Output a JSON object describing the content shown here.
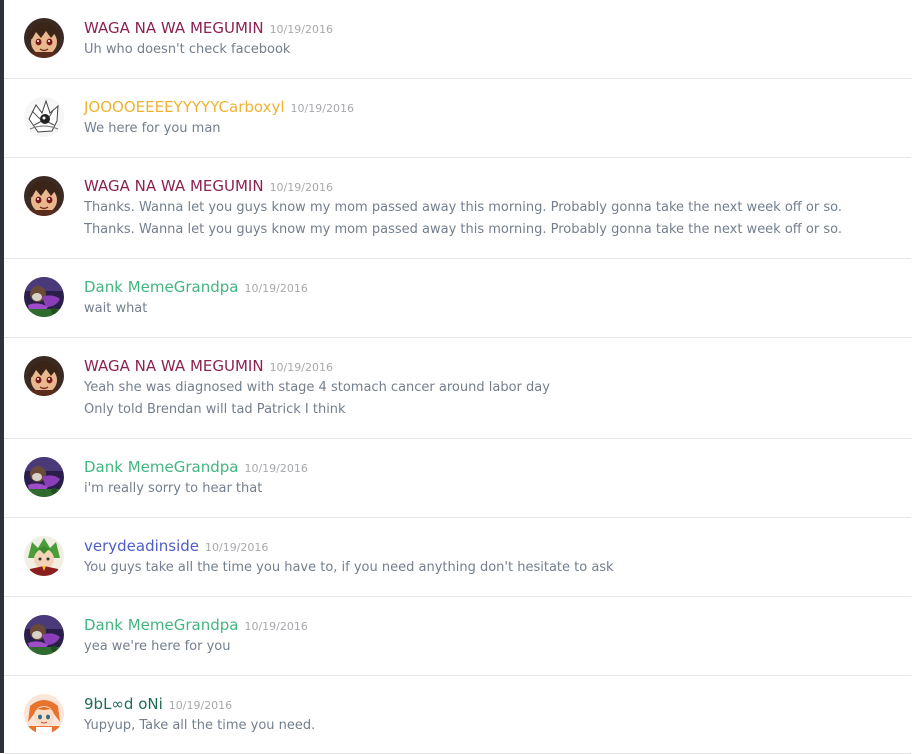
{
  "colors": {
    "megumin": "#8b2252",
    "carboxyl": "#f0b232",
    "dank": "#43b581",
    "verydead": "#4e5dc3",
    "oni": "#1f6b5b",
    "message_text": "#737f8d",
    "timestamp": "#a7a9ac"
  },
  "messages": [
    {
      "username": "WAGA NA WA MEGUMIN",
      "color_key": "megumin",
      "avatar": "megumin-avatar-icon",
      "timestamp": "10/19/2016",
      "lines": [
        "Uh who doesn't check facebook"
      ]
    },
    {
      "username": "JOOOOEEEEYYYYYCarboxyl",
      "color_key": "carboxyl",
      "avatar": "sketch-avatar-icon",
      "timestamp": "10/19/2016",
      "lines": [
        "We here for you man"
      ]
    },
    {
      "username": "WAGA NA WA MEGUMIN",
      "color_key": "megumin",
      "avatar": "megumin-avatar-icon",
      "timestamp": "10/19/2016",
      "lines": [
        "Thanks. Wanna let you guys know my mom passed away this morning. Probably gonna take the next week off or so.",
        "Thanks. Wanna let you guys know my mom passed away this morning. Probably gonna take the next week off or so."
      ]
    },
    {
      "username": "Dank MemeGrandpa",
      "color_key": "dank",
      "avatar": "grandpa-avatar-icon",
      "timestamp": "10/19/2016",
      "lines": [
        "wait what"
      ]
    },
    {
      "username": "WAGA NA WA MEGUMIN",
      "color_key": "megumin",
      "avatar": "megumin-avatar-icon",
      "timestamp": "10/19/2016",
      "lines": [
        "Yeah she was diagnosed with stage 4 stomach cancer around labor day",
        "Only told Brendan will tad Patrick I think"
      ]
    },
    {
      "username": "Dank MemeGrandpa",
      "color_key": "dank",
      "avatar": "grandpa-avatar-icon",
      "timestamp": "10/19/2016",
      "lines": [
        "i'm really sorry to hear that"
      ]
    },
    {
      "username": "verydeadinside",
      "color_key": "verydead",
      "avatar": "green-hair-avatar-icon",
      "timestamp": "10/19/2016",
      "lines": [
        "You guys take all the time you have to, if you need anything don't hesitate to ask"
      ]
    },
    {
      "username": "Dank MemeGrandpa",
      "color_key": "dank",
      "avatar": "grandpa-avatar-icon",
      "timestamp": "10/19/2016",
      "lines": [
        "yea we're here for you"
      ]
    },
    {
      "username": "9bL∞d oNi",
      "color_key": "oni",
      "avatar": "orange-hair-avatar-icon",
      "timestamp": "10/19/2016",
      "lines": [
        "Yupyup, Take all the time you need."
      ]
    }
  ]
}
